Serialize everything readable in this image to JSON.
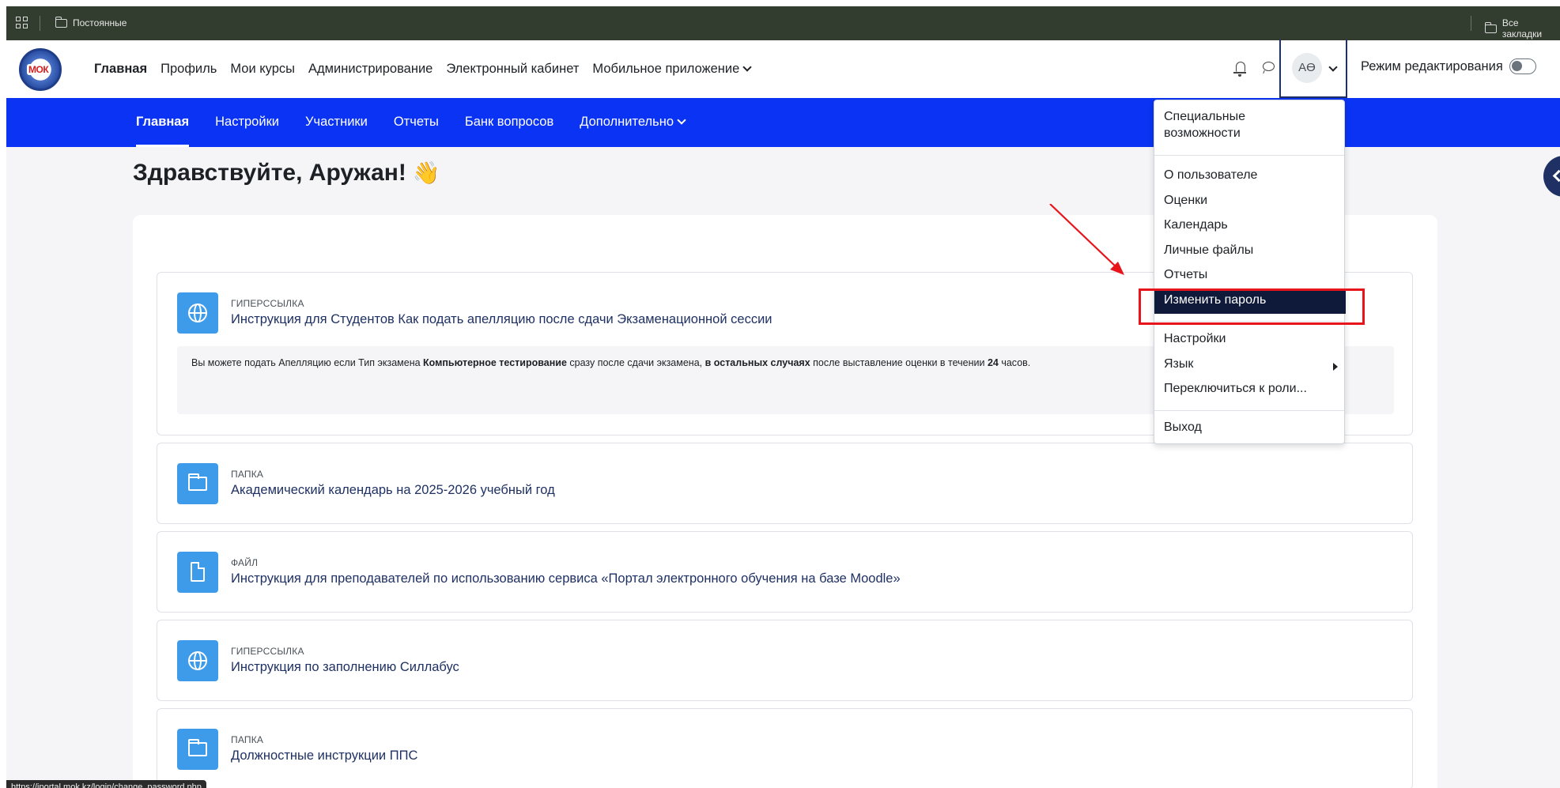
{
  "browser": {
    "bookmark_folder": "Постоянные",
    "all_bookmarks": "Все закладки"
  },
  "logo": {
    "text": "МОК"
  },
  "topnav": {
    "items": [
      "Главная",
      "Профиль",
      "Мои курсы",
      "Администрирование",
      "Электронный кабинет",
      "Мобильное приложение"
    ],
    "active": "Главная",
    "user_initials": "АӨ",
    "edit_mode_label": "Режим редактирования"
  },
  "secondary_nav": {
    "items": [
      "Главная",
      "Настройки",
      "Участники",
      "Отчеты",
      "Банк вопросов",
      "Дополнительно"
    ],
    "active": "Главная"
  },
  "greeting": {
    "text": "Здравствуйте, Аружан!",
    "emoji": "👋"
  },
  "activities": [
    {
      "type": "ГИПЕРССЫЛКА",
      "name": "Инструкция для Студентов Как подать апелляцию после сдачи Экзаменационной сессии",
      "icon": "globe-icon",
      "description": {
        "p1": "Вы можете подать Апелляцию если Тип экзамена ",
        "b1": "Компьютерное тестирование",
        "p2": " сразу после сдачи экзамена, ",
        "b2": "в остальных случаях",
        "p3": " после выставление оценки в течении ",
        "b3": "24",
        "p4": " часов."
      }
    },
    {
      "type": "ПАПКА",
      "name": "Академический календарь на 2025-2026 учебный год",
      "icon": "folder-icon"
    },
    {
      "type": "ФАЙЛ",
      "name": "Инструкция для преподавателей по использованию сервиса «Портал электронного обучения на базе Moodle»",
      "icon": "file-icon"
    },
    {
      "type": "ГИПЕРССЫЛКА",
      "name": "Инструкция по заполнению Силлабус",
      "icon": "globe-icon"
    },
    {
      "type": "ПАПКА",
      "name": "Должностные инструкции ППС",
      "icon": "folder-icon"
    }
  ],
  "user_menu": {
    "accessibility_line1": "Специальные",
    "accessibility_line2": "возможности",
    "profile": "О пользователе",
    "grades": "Оценки",
    "calendar": "Календарь",
    "private_files": "Личные файлы",
    "reports": "Отчеты",
    "change_password": "Изменить пароль",
    "preferences": "Настройки",
    "language": "Язык",
    "switch_role": "Переключиться к роли...",
    "logout": "Выход"
  },
  "status_url": "https://iportal.mok.kz/login/change_password.php",
  "colors": {
    "bookmark_bar": "#333d2f",
    "secondary_nav": "#0a33f3",
    "activity_icon": "#3d9be9",
    "menu_active": "#0f1a3a",
    "annotation": "#e8141b"
  }
}
